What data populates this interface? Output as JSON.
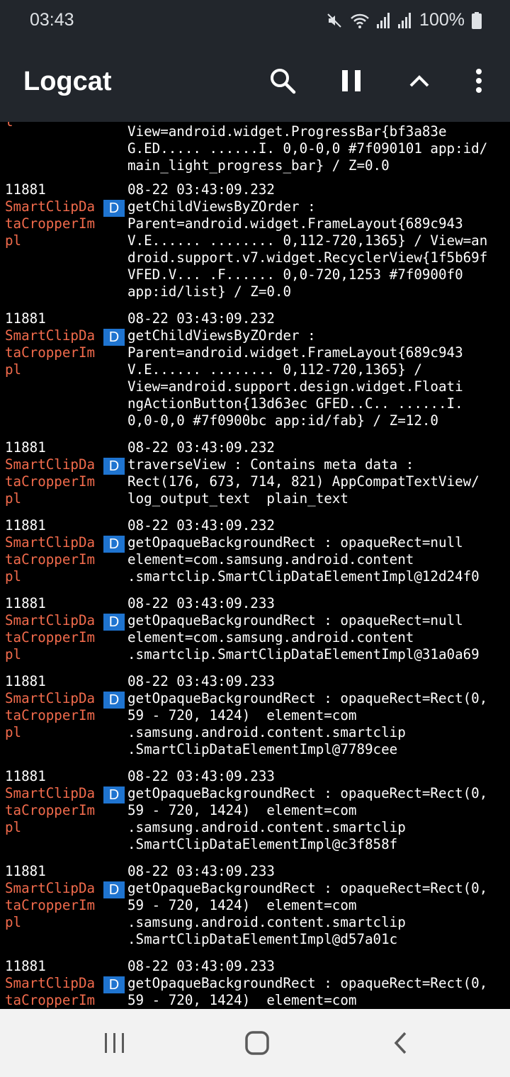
{
  "status_bar": {
    "time": "03:43",
    "battery": "100%",
    "icons": [
      "mute-icon",
      "wifi-icon",
      "signal-icon",
      "signal-icon",
      "battery-icon"
    ]
  },
  "app_bar": {
    "title": "Logcat",
    "actions": [
      "search-icon",
      "pause-icon",
      "chevron-up-icon",
      "more-vert-icon"
    ]
  },
  "log": {
    "top_partial": {
      "tag_fragment": "l",
      "lines": [
        "View=android.widget.ProgressBar{bf3a83e",
        "G.ED..... ......I. 0,0-0,0 #7f090101 app:id/",
        "main_light_progress_bar} / Z=0.0"
      ]
    },
    "entries": [
      {
        "pid": "11881",
        "time": "08-22 03:43:09.232",
        "tag": [
          "SmartClipDa",
          "taCropperIm",
          "pl"
        ],
        "level": "D",
        "lines": [
          "getChildViewsByZOrder :",
          "Parent=android.widget.FrameLayout{689c943",
          "V.E...... ........ 0,112-720,1365} / View=an",
          "droid.support.v7.widget.RecyclerView{1f5b69f",
          "VFED.V... .F...... 0,0-720,1253 #7f0900f0",
          "app:id/list} / Z=0.0"
        ]
      },
      {
        "pid": "11881",
        "time": "08-22 03:43:09.232",
        "tag": [
          "SmartClipDa",
          "taCropperIm",
          "pl"
        ],
        "level": "D",
        "lines": [
          "getChildViewsByZOrder :",
          "Parent=android.widget.FrameLayout{689c943",
          "V.E...... ........ 0,112-720,1365} /",
          "View=android.support.design.widget.Floati",
          "ngActionButton{13d63ec GFED..C.. ......I.",
          "0,0-0,0 #7f0900bc app:id/fab} / Z=12.0"
        ]
      },
      {
        "pid": "11881",
        "time": "08-22 03:43:09.232",
        "tag": [
          "SmartClipDa",
          "taCropperIm",
          "pl"
        ],
        "level": "D",
        "lines": [
          "traverseView : Contains meta data :",
          "Rect(176, 673, 714, 821) AppCompatTextView/",
          "log_output_text  plain_text"
        ]
      },
      {
        "pid": "11881",
        "time": "08-22 03:43:09.232",
        "tag": [
          "SmartClipDa",
          "taCropperIm",
          "pl"
        ],
        "level": "D",
        "lines": [
          "getOpaqueBackgroundRect : opaqueRect=null",
          "element=com.samsung.android.content",
          ".smartclip.SmartClipDataElementImpl@12d24f0"
        ]
      },
      {
        "pid": "11881",
        "time": "08-22 03:43:09.233",
        "tag": [
          "SmartClipDa",
          "taCropperIm",
          "pl"
        ],
        "level": "D",
        "lines": [
          "getOpaqueBackgroundRect : opaqueRect=null",
          "element=com.samsung.android.content",
          ".smartclip.SmartClipDataElementImpl@31a0a69"
        ]
      },
      {
        "pid": "11881",
        "time": "08-22 03:43:09.233",
        "tag": [
          "SmartClipDa",
          "taCropperIm",
          "pl"
        ],
        "level": "D",
        "lines": [
          "getOpaqueBackgroundRect : opaqueRect=Rect(0,",
          "59 - 720, 1424)  element=com",
          ".samsung.android.content.smartclip",
          ".SmartClipDataElementImpl@7789cee"
        ]
      },
      {
        "pid": "11881",
        "time": "08-22 03:43:09.233",
        "tag": [
          "SmartClipDa",
          "taCropperIm",
          "pl"
        ],
        "level": "D",
        "lines": [
          "getOpaqueBackgroundRect : opaqueRect=Rect(0,",
          "59 - 720, 1424)  element=com",
          ".samsung.android.content.smartclip",
          ".SmartClipDataElementImpl@c3f858f"
        ]
      },
      {
        "pid": "11881",
        "time": "08-22 03:43:09.233",
        "tag": [
          "SmartClipDa",
          "taCropperIm",
          "pl"
        ],
        "level": "D",
        "lines": [
          "getOpaqueBackgroundRect : opaqueRect=Rect(0,",
          "59 - 720, 1424)  element=com",
          ".samsung.android.content.smartclip",
          ".SmartClipDataElementImpl@d57a01c"
        ]
      },
      {
        "pid": "11881",
        "time": "08-22 03:43:09.233",
        "tag": [
          "SmartClipDa",
          "taCropperIm"
        ],
        "level": "D",
        "lines": [
          "getOpaqueBackgroundRect : opaqueRect=Rect(0,",
          "59 - 720, 1424)  element=com"
        ]
      }
    ]
  },
  "nav_bar": {
    "buttons": [
      "recents-icon",
      "home-icon",
      "back-icon"
    ]
  },
  "colors": {
    "app_bar": "#22262c",
    "log_background": "#000000",
    "tag_text": "#f26b4c",
    "level_badge": "#1f74d0",
    "nav_bar": "#f2f2f2"
  }
}
